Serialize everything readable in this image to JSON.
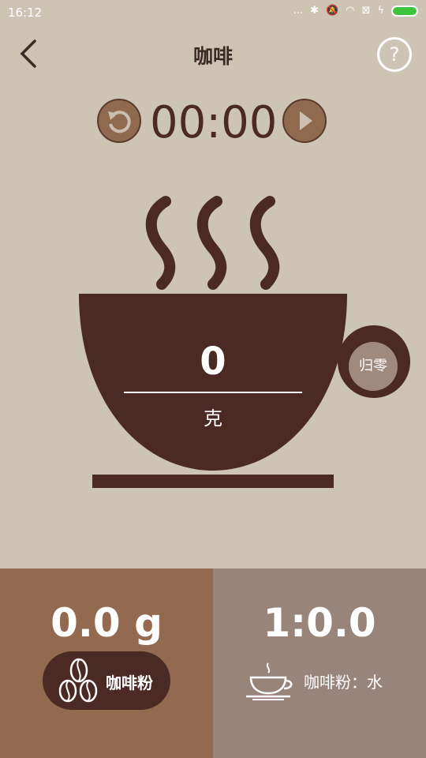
{
  "status": {
    "time": "16:12",
    "dots": "...",
    "signal": "⊠"
  },
  "header": {
    "title": "咖啡",
    "help": "?"
  },
  "timer": {
    "value": "00:00"
  },
  "scale": {
    "weight": "0",
    "unit": "克",
    "zero_label": "归零"
  },
  "colors": {
    "background": "#cdc4b4",
    "cup": "#4a2a22",
    "left_panel": "#936a4f",
    "right_panel": "#998479"
  },
  "coffee": {
    "amount": "0.0 g",
    "label": "咖啡粉"
  },
  "ratio": {
    "value": "1:0.0",
    "label": "咖啡粉：水"
  }
}
